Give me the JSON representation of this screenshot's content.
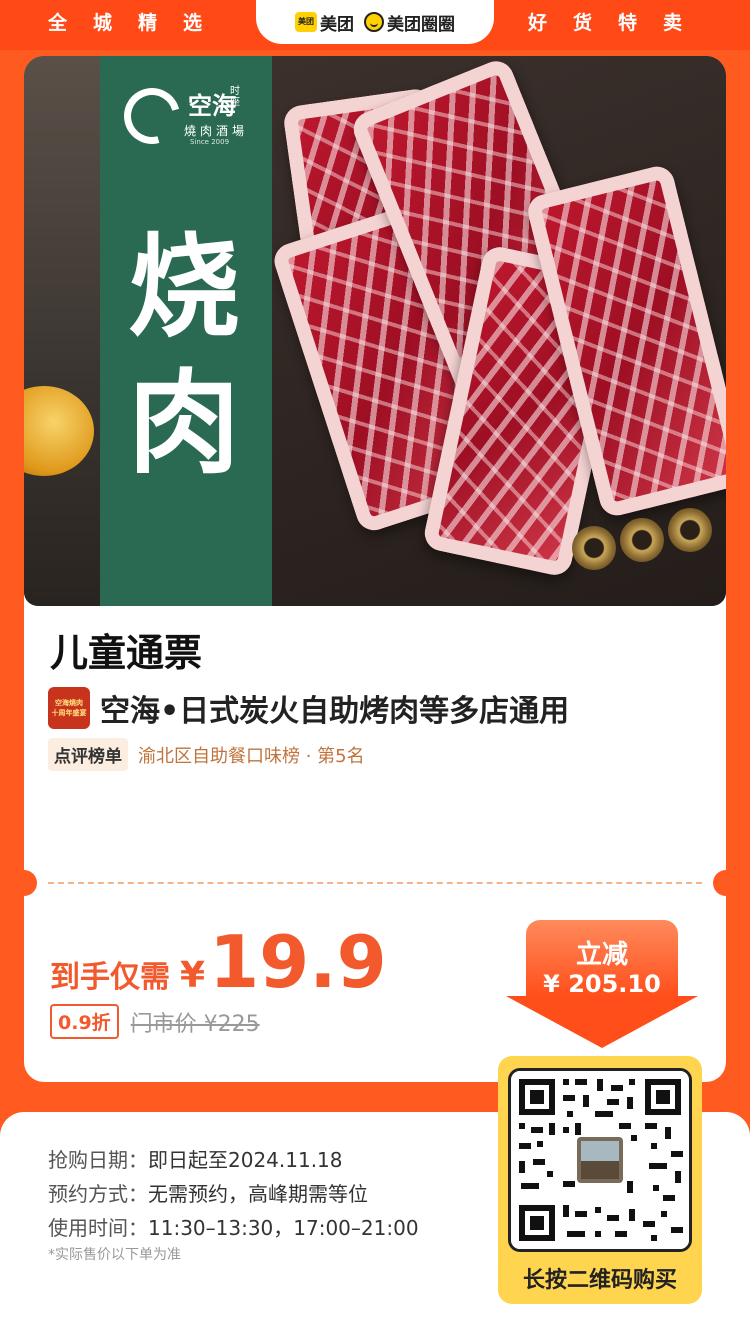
{
  "header": {
    "slogan_left": "全城精选",
    "slogan_right": "好货特卖",
    "brand_meituan": "美团",
    "brand_meituan_logo_text": "美团",
    "brand_quanquan": "美团圈圈"
  },
  "hero": {
    "logo_name": "空海",
    "logo_sub_vertical": "时座",
    "logo_sub": "燒肉酒場",
    "logo_since": "Since 2009",
    "title_char_1": "烧",
    "title_char_2": "肉"
  },
  "product": {
    "title": "儿童通票",
    "shop_name": "空海•日式炭火自助烤肉等多店通用",
    "shop_thumb_line1": "空海燒肉",
    "shop_thumb_line2": "十周年盛宴",
    "rank_badge": "点评榜单",
    "rank_text": "渝北区自助餐口味榜 · 第5名"
  },
  "price": {
    "prefix": "到手仅需",
    "currency": "¥",
    "value": "19.9",
    "discount": "0.9折",
    "market_price": "门市价 ¥225"
  },
  "reduce": {
    "label": "立减",
    "amount": "¥ 205.10"
  },
  "details": {
    "purchase_label": "抢购日期：",
    "purchase_value": "即日起至2024.11.18",
    "booking_label": "预约方式：",
    "booking_value": "无需预约，高峰期需等位",
    "usage_label": "使用时间：",
    "usage_value": "11:30–13:30，17:00–21:00",
    "footnote": "*实际售价以下单为准"
  },
  "qr": {
    "caption": "长按二维码购买"
  },
  "colors": {
    "brand_orange": "#ff5a1f",
    "price_red": "#f25a2d",
    "panel_green": "#2a6a52",
    "qr_yellow": "#ffd54f"
  }
}
